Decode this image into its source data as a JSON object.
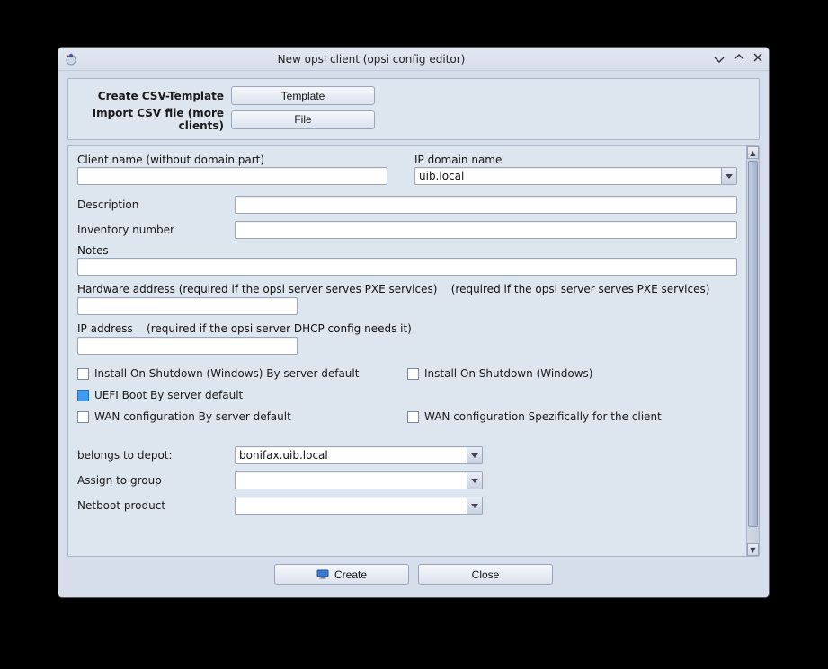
{
  "window": {
    "title": "New opsi client (opsi config editor)"
  },
  "top": {
    "csv_template_label": "Create CSV-Template",
    "template_button": "Template",
    "import_csv_label": "Import CSV file (more clients)",
    "file_button": "File"
  },
  "form": {
    "client_name_label": "Client name (without domain part)",
    "client_name_value": "",
    "ip_domain_label": "IP domain name",
    "ip_domain_value": "uib.local",
    "description_label": "Description",
    "description_value": "",
    "inventory_label": "Inventory number",
    "inventory_value": "",
    "notes_label": "Notes",
    "notes_value": "",
    "hw_addr_label": "Hardware address (required if the opsi server serves PXE services)",
    "hw_addr_hint": "(required if the opsi server serves PXE services)",
    "hw_addr_value": "",
    "ip_addr_label": "IP address",
    "ip_addr_hint": "(required if the opsi server DHCP config needs it)",
    "ip_addr_value": ""
  },
  "checks": {
    "ios_default_label": "Install On Shutdown (Windows) By server default",
    "ios_label": "Install On Shutdown (Windows)",
    "uefi_default_label": "UEFI Boot By server default",
    "wan_default_label": "WAN configuration By server default",
    "wan_client_label": "WAN configuration Spezifically for the client"
  },
  "dropdowns": {
    "depot_label": "belongs to depot:",
    "depot_value": "bonifax.uib.local",
    "group_label": "Assign to group",
    "group_value": "",
    "netboot_label": "Netboot product",
    "netboot_value": ""
  },
  "footer": {
    "create": "Create",
    "close": "Close"
  }
}
